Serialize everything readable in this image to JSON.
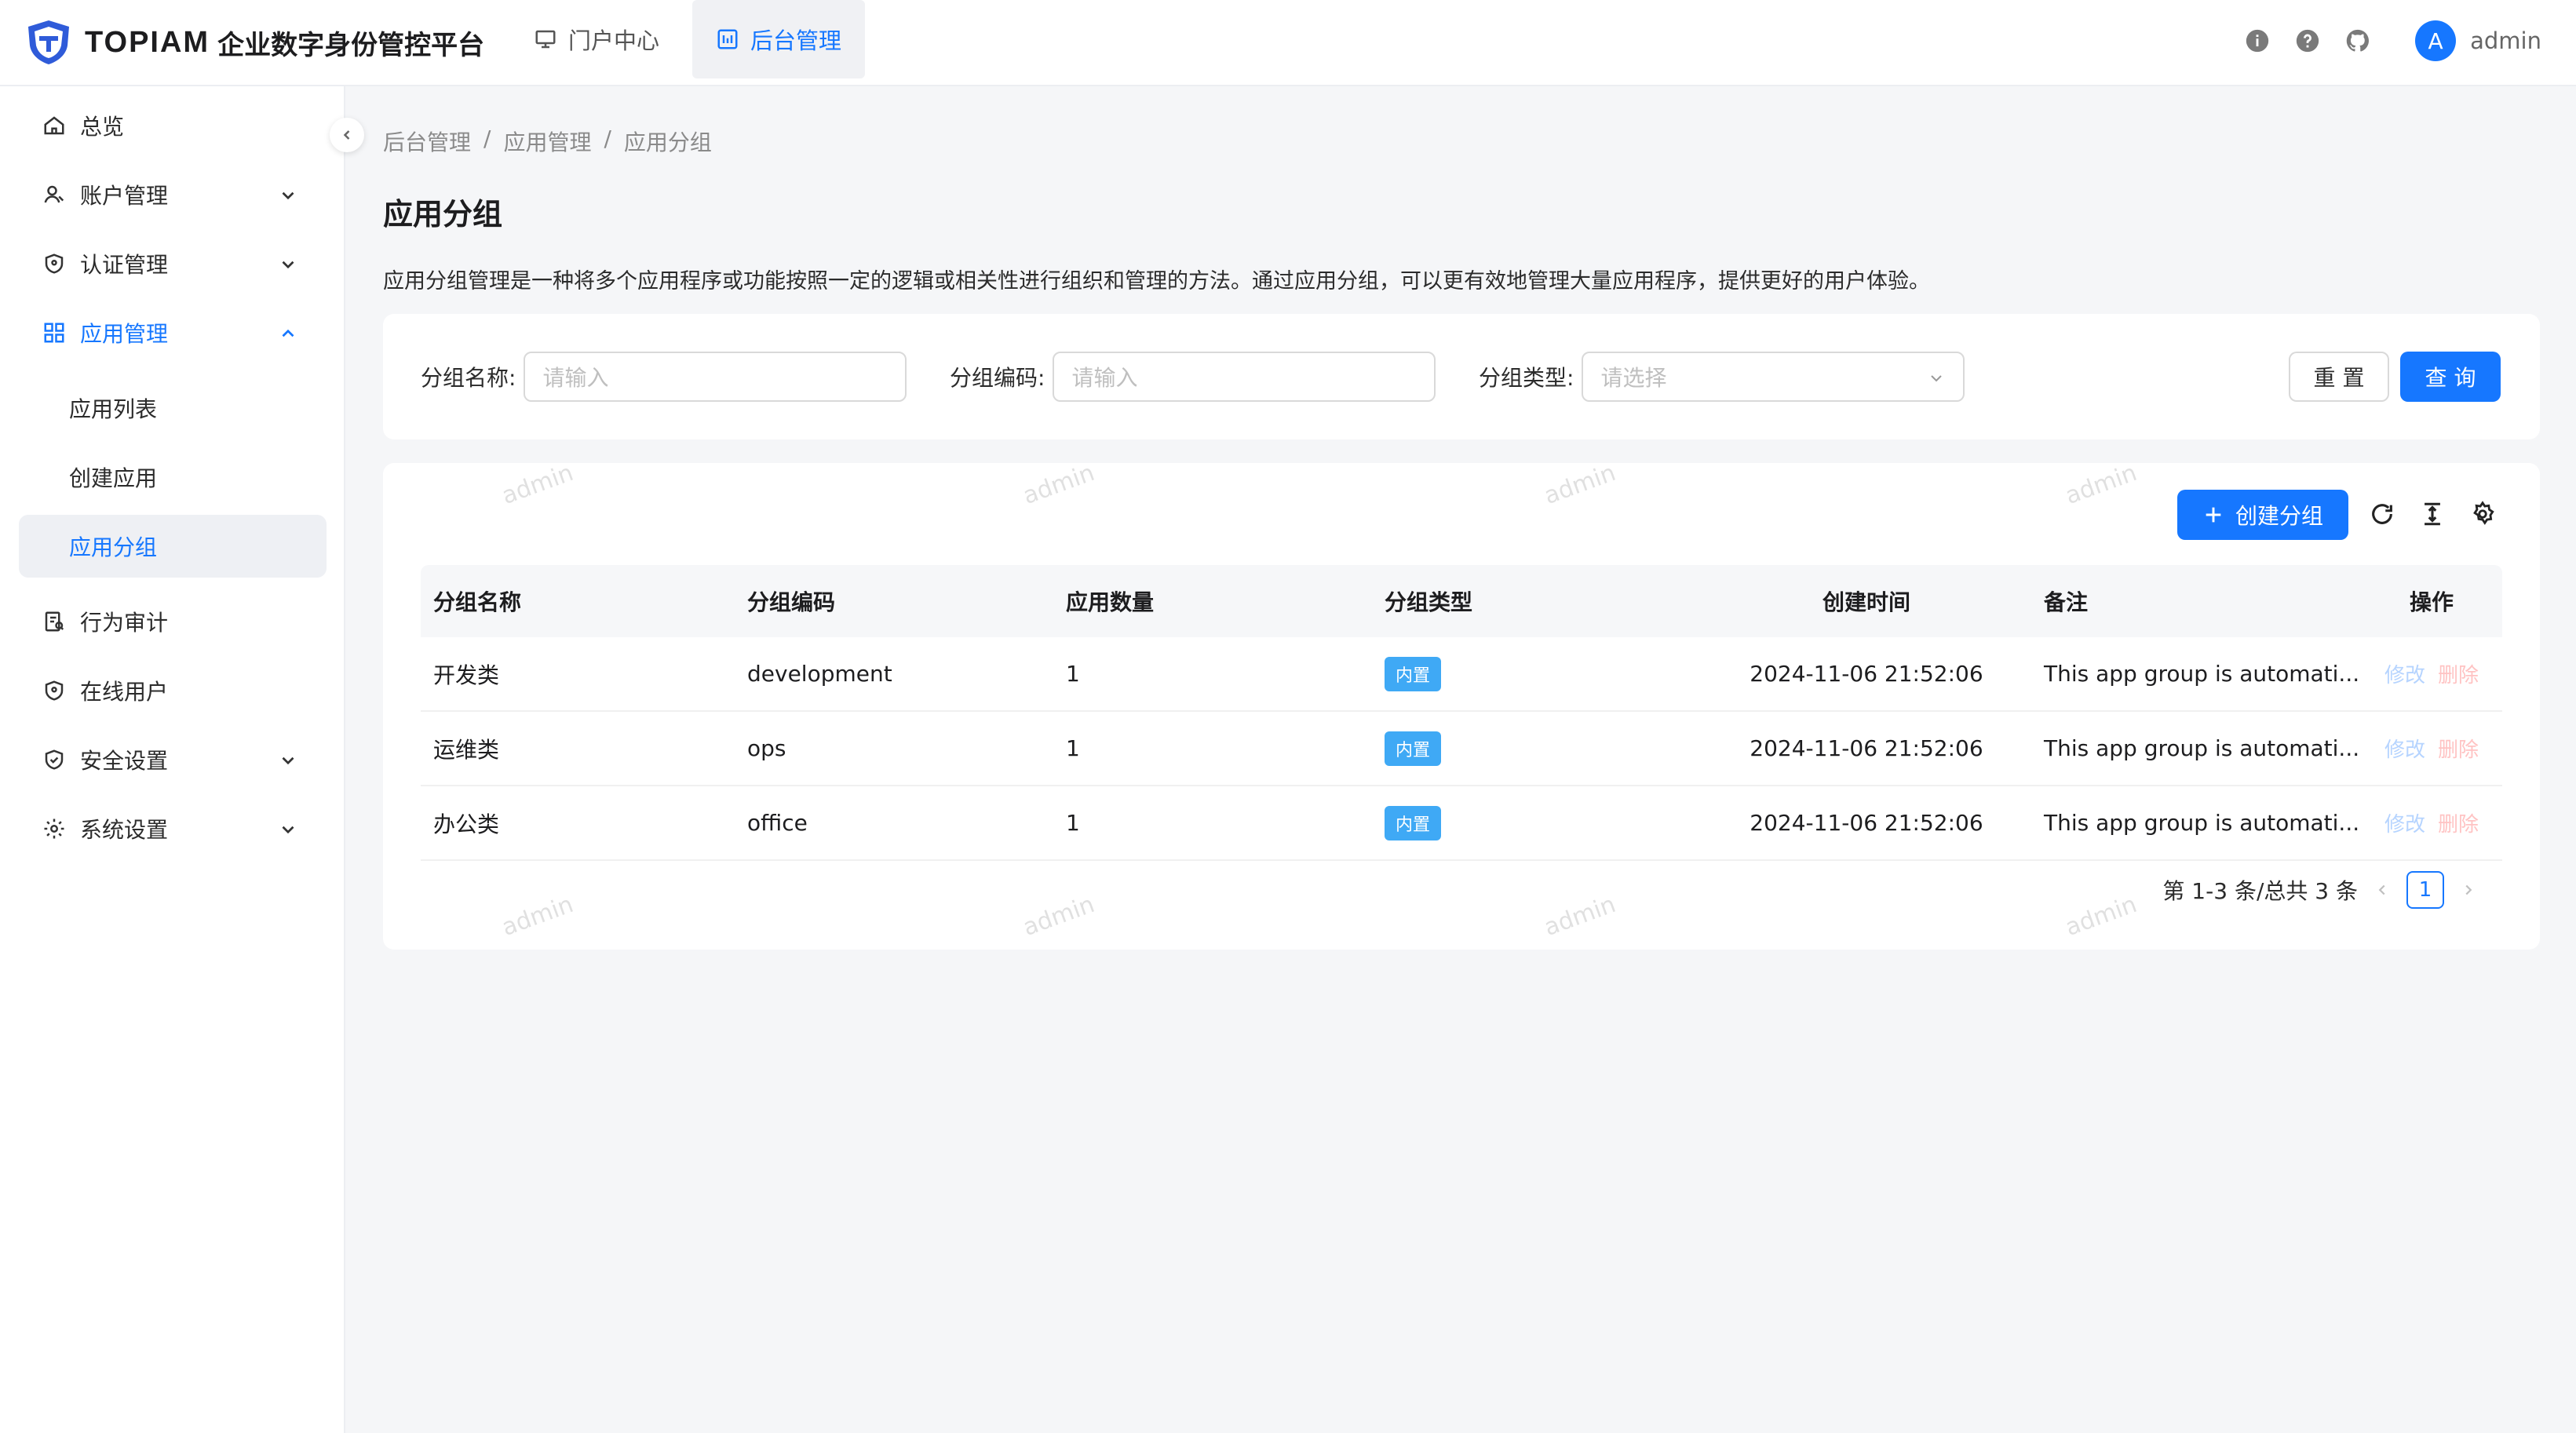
{
  "header": {
    "brand": "TOPIAM",
    "brand_sub": "企业数字身份管控平台",
    "nav": [
      {
        "label": "门户中心",
        "icon": "monitor-icon",
        "active": false
      },
      {
        "label": "后台管理",
        "icon": "dashboard-icon",
        "active": true
      }
    ],
    "username": "admin",
    "avatar_letter": "A"
  },
  "sidebar": {
    "items": [
      {
        "label": "总览",
        "icon": "home-icon"
      },
      {
        "label": "账户管理",
        "icon": "user-icon"
      },
      {
        "label": "认证管理",
        "icon": "shield-icon"
      },
      {
        "label": "应用管理",
        "icon": "apps-icon"
      },
      {
        "label": "应用列表"
      },
      {
        "label": "创建应用"
      },
      {
        "label": "应用分组"
      },
      {
        "label": "行为审计",
        "icon": "audit-icon"
      },
      {
        "label": "在线用户",
        "icon": "shield-icon"
      },
      {
        "label": "安全设置",
        "icon": "shield-check-icon"
      },
      {
        "label": "系统设置",
        "icon": "gear-icon"
      }
    ]
  },
  "breadcrumb": [
    "后台管理",
    "应用管理",
    "应用分组"
  ],
  "page": {
    "title": "应用分组",
    "description": "应用分组管理是一种将多个应用程序或功能按照一定的逻辑或相关性进行组织和管理的方法。通过应用分组，可以更有效地管理大量应用程序，提供更好的用户体验。"
  },
  "filter": {
    "name_label": "分组名称:",
    "name_placeholder": "请输入",
    "code_label": "分组编码:",
    "code_placeholder": "请输入",
    "type_label": "分组类型:",
    "type_placeholder": "请选择",
    "reset": "重 置",
    "search": "查 询"
  },
  "toolbar": {
    "create": "创建分组"
  },
  "table": {
    "columns": [
      "分组名称",
      "分组编码",
      "应用数量",
      "分组类型",
      "创建时间",
      "备注",
      "操作"
    ],
    "rows": [
      {
        "name": "开发类",
        "code": "development",
        "count": "1",
        "type": "内置",
        "created": "2024-11-06 21:52:06",
        "remark": "This app group is automati...",
        "edit": "修改",
        "delete": "删除"
      },
      {
        "name": "运维类",
        "code": "ops",
        "count": "1",
        "type": "内置",
        "created": "2024-11-06 21:52:06",
        "remark": "This app group is automati...",
        "edit": "修改",
        "delete": "删除"
      },
      {
        "name": "办公类",
        "code": "office",
        "count": "1",
        "type": "内置",
        "created": "2024-11-06 21:52:06",
        "remark": "This app group is automati...",
        "edit": "修改",
        "delete": "删除"
      }
    ]
  },
  "pagination": {
    "summary": "第 1-3 条/总共 3 条",
    "current": "1"
  },
  "watermark": "admin",
  "colors": {
    "primary": "#1677ff",
    "tag": "#3fa9f5"
  }
}
